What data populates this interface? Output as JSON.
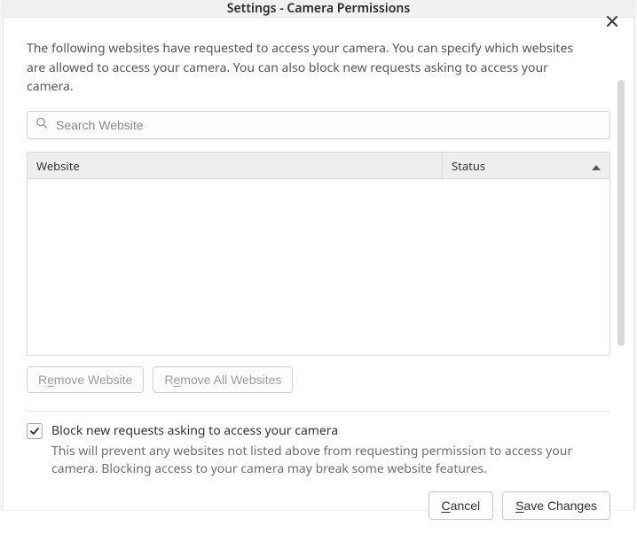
{
  "dialog": {
    "title": "Settings - Camera Permissions",
    "intro": "The following websites have requested to access your camera. You can specify which websites are allowed to access your camera. You can also block new requests asking to access your camera."
  },
  "search": {
    "placeholder": "Search Website",
    "value": ""
  },
  "table": {
    "columns": {
      "website": "Website",
      "status": "Status"
    },
    "rows": []
  },
  "buttons": {
    "remove_website_pre": "R",
    "remove_website_ul": "e",
    "remove_website_post": "move Website",
    "remove_all_pre": "R",
    "remove_all_ul": "e",
    "remove_all_post": "move All Websites"
  },
  "checkbox": {
    "checked": true,
    "label": "Block new requests asking to access your camera",
    "description": "This will prevent any websites not listed above from requesting permission to access your camera. Blocking access to your camera may break some website features."
  },
  "actions": {
    "cancel_ul": "C",
    "cancel_post": "ancel",
    "save_ul": "S",
    "save_post": "ave Changes"
  }
}
